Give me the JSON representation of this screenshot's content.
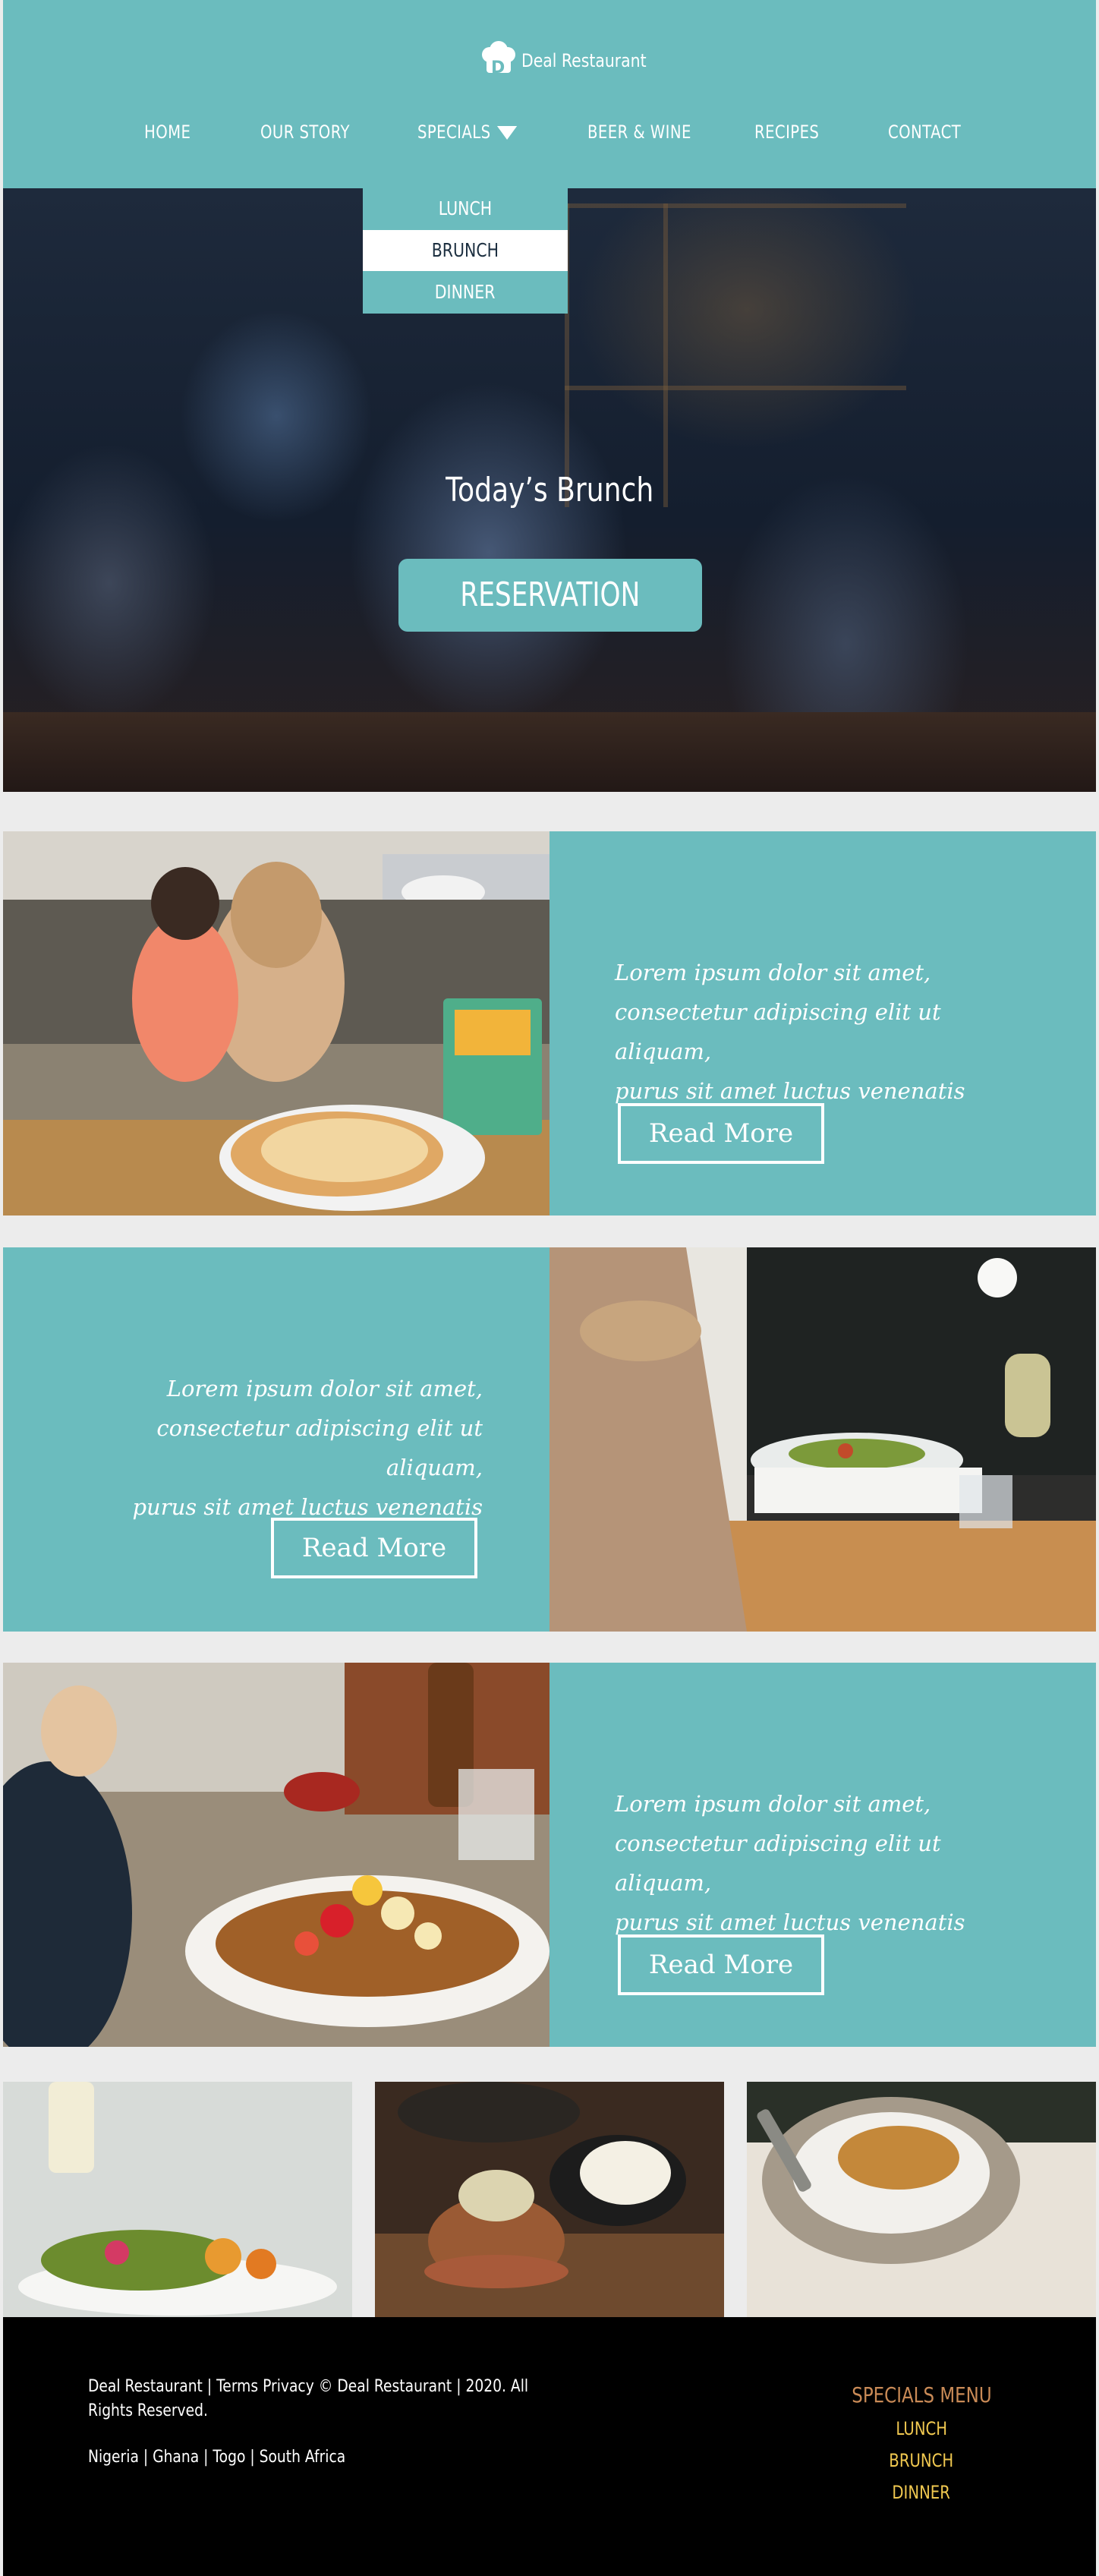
{
  "brand": {
    "name": "Deal Restaurant",
    "logo_icon": "chef-hat-icon"
  },
  "nav": {
    "items": [
      {
        "label": "HOME"
      },
      {
        "label": "OUR STORY"
      },
      {
        "label": "SPECIALS"
      },
      {
        "label": "BEER & WINE"
      },
      {
        "label": "RECIPES"
      },
      {
        "label": "CONTACT"
      }
    ],
    "dropdown": [
      {
        "label": "LUNCH"
      },
      {
        "label": "BRUNCH",
        "active": true
      },
      {
        "label": "DINNER"
      }
    ]
  },
  "hero": {
    "title": "Today’s Brunch",
    "button": "RESERVATION"
  },
  "features": [
    {
      "line1": "Lorem ipsum dolor sit amet,",
      "line2": "consectetur adipiscing elit ut aliquam,",
      "line3": "purus sit amet luctus venenatis",
      "button": "Read More"
    },
    {
      "line1": "Lorem ipsum dolor sit amet,",
      "line2": "consectetur adipiscing elit ut aliquam,",
      "line3": "purus sit amet luctus venenatis",
      "button": "Read More"
    },
    {
      "line1": "Lorem ipsum dolor sit amet,",
      "line2": "consectetur adipiscing elit ut aliquam,",
      "line3": "purus sit amet luctus venenatis",
      "button": "Read More"
    }
  ],
  "footer": {
    "legal": "Deal Restaurant  | Terms Privacy © Deal Restaurant  |  2020. All Rights Reserved.",
    "countries": "Nigeria | Ghana | Togo | South Africa",
    "specials_menu": {
      "title": "SPECIALS MENU",
      "items": [
        "LUNCH",
        "BRUNCH",
        "DINNER"
      ]
    }
  },
  "colors": {
    "teal": "#6bbcbe",
    "footer_bg": "#000000",
    "specials_title": "#c98a56",
    "specials_items": "#f0c850"
  }
}
